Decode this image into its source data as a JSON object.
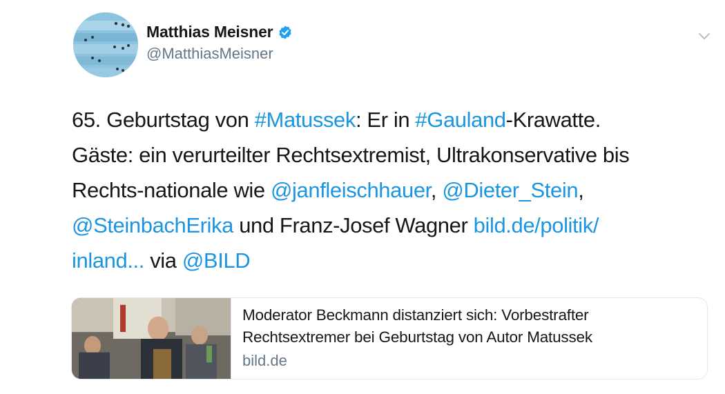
{
  "author": {
    "display_name": "Matthias Meisner",
    "handle": "@MatthiasMeisner",
    "verified_icon": "verified-badge-icon",
    "verified_color": "#1da1f2"
  },
  "menu_icon": "chevron-down-icon",
  "tweet": {
    "line1": {
      "t1": "65. Geburtstag von ",
      "l1": "#Matussek",
      "t2": ": Er in ",
      "l2": "#Gauland",
      "t3": "-Krawatte."
    },
    "line2": {
      "t1": "Gäste: ein verurteilter Rechtsextremist, Ultrakonservative bis"
    },
    "line3": {
      "t1": "Rechts-nationale wie ",
      "l1": "@janfleischhauer",
      "t2": ", ",
      "l2": "@Dieter_Stein",
      "t3": ","
    },
    "line4": {
      "l1": "@SteinbachErika",
      "t1": " und Franz-Josef Wagner ",
      "l2": "bild.de/politik/"
    },
    "line5": {
      "l1": "inland...",
      "t1": " via ",
      "l2": "@BILD"
    }
  },
  "card": {
    "title_line1": "Moderator Beckmann distanziert sich: Vorbestrafter",
    "title_line2": "Rechtsextremer bei Geburtstag von Autor Matussek",
    "domain": "bild.de"
  },
  "colors": {
    "link": "#1b95e0",
    "text": "#14171a",
    "secondary": "#657786",
    "border": "#e1e8ed"
  }
}
